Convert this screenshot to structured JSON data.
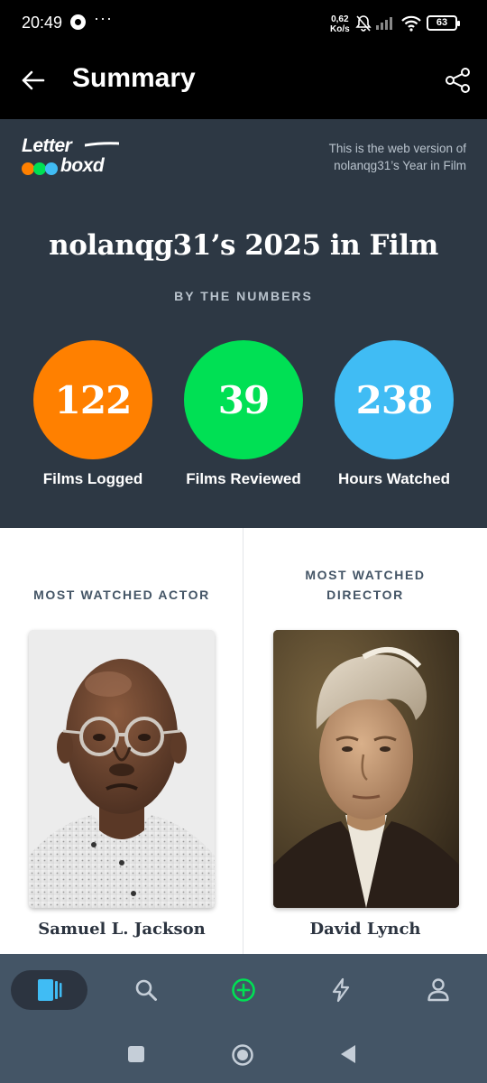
{
  "status_bar": {
    "time": "20:49",
    "dots": "···",
    "net_speed_value": "0,62",
    "net_speed_unit": "Ko/s",
    "battery": "63"
  },
  "app_bar": {
    "title": "Summary"
  },
  "logo": {
    "word_top": "Letter",
    "word_bottom": "boxd",
    "dot_colors": [
      "#ff8000",
      "#00e054",
      "#40bcf4"
    ]
  },
  "header": {
    "web_note": "This is the web version of nolanqg31’s Year in Film",
    "title": "nolanqg31’s 2025 in Film",
    "subtitle": "BY THE NUMBERS",
    "stats": [
      {
        "value": "122",
        "label": "Films Logged",
        "color": "#ff8000"
      },
      {
        "value": "39",
        "label": "Films Reviewed",
        "color": "#00e054"
      },
      {
        "value": "238",
        "label": "Hours Watched",
        "color": "#40bcf4"
      }
    ]
  },
  "people": {
    "actor": {
      "heading": "MOST WATCHED ACTOR",
      "name": "Samuel L. Jackson"
    },
    "director": {
      "heading_line1": "MOST WATCHED",
      "heading_line2": "DIRECTOR",
      "name": "David Lynch"
    }
  },
  "bottom_nav": [
    "films-icon",
    "search-icon",
    "add-icon",
    "activity-icon",
    "profile-icon"
  ],
  "system_nav": [
    "recents-icon",
    "home-icon",
    "back-icon"
  ]
}
